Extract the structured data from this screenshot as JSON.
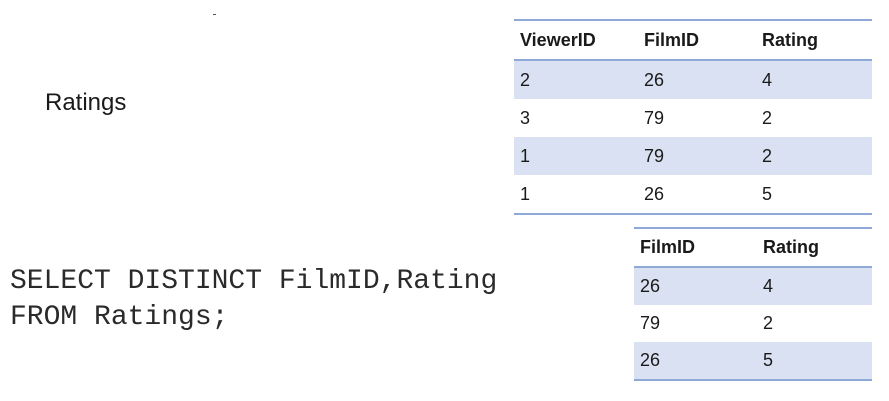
{
  "table_title": "Ratings",
  "sql": {
    "line1": "SELECT DISTINCT FilmID,Rating",
    "line2": "FROM Ratings;"
  },
  "ratings_table": {
    "headers": [
      "ViewerID",
      "FilmID",
      "Rating"
    ],
    "rows": [
      [
        "2",
        "26",
        "4"
      ],
      [
        "3",
        "79",
        "2"
      ],
      [
        "1",
        "79",
        "2"
      ],
      [
        "1",
        "26",
        "5"
      ]
    ]
  },
  "result_table": {
    "headers": [
      "FilmID",
      "Rating"
    ],
    "rows": [
      [
        "26",
        "4"
      ],
      [
        "79",
        "2"
      ],
      [
        "26",
        "5"
      ]
    ]
  },
  "colors": {
    "header_border": "#8fa9d6",
    "row_shade": "#d9e1f2"
  }
}
